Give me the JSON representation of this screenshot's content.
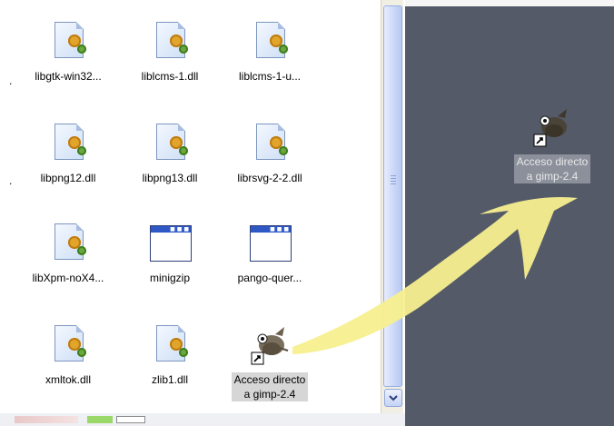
{
  "explorer": {
    "left_stubs": [
      ".",
      ".",
      ""
    ],
    "items": [
      {
        "label": "libgtk-win32...",
        "icon": "dll-icon"
      },
      {
        "label": "liblcms-1.dll",
        "icon": "dll-icon"
      },
      {
        "label": "liblcms-1-u...",
        "icon": "dll-icon"
      },
      {
        "label": "libpng12.dll",
        "icon": "dll-icon"
      },
      {
        "label": "libpng13.dll",
        "icon": "dll-icon"
      },
      {
        "label": "librsvg-2-2.dll",
        "icon": "dll-icon"
      },
      {
        "label": "libXpm-noX4...",
        "icon": "dll-icon"
      },
      {
        "label": "minigzip",
        "icon": "window-icon"
      },
      {
        "label": "pango-quer...",
        "icon": "window-icon"
      },
      {
        "label": "xmltok.dll",
        "icon": "dll-icon"
      },
      {
        "label": "zlib1.dll",
        "icon": "dll-icon"
      },
      {
        "label_line1": "Acceso directo",
        "label_line2": "a gimp-2.4",
        "icon": "gimp-shortcut-icon"
      }
    ]
  },
  "desktop": {
    "shortcut": {
      "label_line1": "Acceso directo",
      "label_line2": "a gimp-2.4",
      "icon": "gimp-shortcut-icon"
    }
  },
  "colors": {
    "desktop_bg": "#545a67",
    "arrow": "#f7ef8f",
    "selection": "#d6d6d6"
  }
}
